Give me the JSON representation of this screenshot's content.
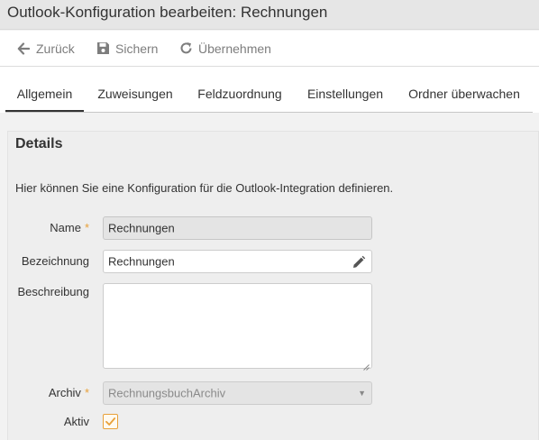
{
  "window": {
    "title": "Outlook-Konfiguration bearbeiten: Rechnungen"
  },
  "toolbar": {
    "back_label": "Zurück",
    "save_label": "Sichern",
    "apply_label": "Übernehmen",
    "back_icon": "arrow-left-icon",
    "save_icon": "floppy-disk-icon",
    "apply_icon": "refresh-icon"
  },
  "tabs": [
    {
      "label": "Allgemein",
      "active": true
    },
    {
      "label": "Zuweisungen",
      "active": false
    },
    {
      "label": "Feldzuordnung",
      "active": false
    },
    {
      "label": "Einstellungen",
      "active": false
    },
    {
      "label": "Ordner überwachen",
      "active": false
    }
  ],
  "details": {
    "title": "Details",
    "description": "Hier können Sie eine Konfiguration für die Outlook-Integration definieren.",
    "fields": {
      "name": {
        "label": "Name",
        "required_marker": "*",
        "value": "Rechnungen"
      },
      "bezeichnung": {
        "label": "Bezeichnung",
        "value": "Rechnungen"
      },
      "beschreibung": {
        "label": "Beschreibung",
        "value": ""
      },
      "archiv": {
        "label": "Archiv",
        "required_marker": "*",
        "value": "RechnungsbuchArchiv"
      },
      "aktiv": {
        "label": "Aktiv",
        "checked": true
      }
    }
  },
  "colors": {
    "accent": "#e8a13a",
    "text": "#333333",
    "toolbar_text": "#7d7d7d"
  }
}
